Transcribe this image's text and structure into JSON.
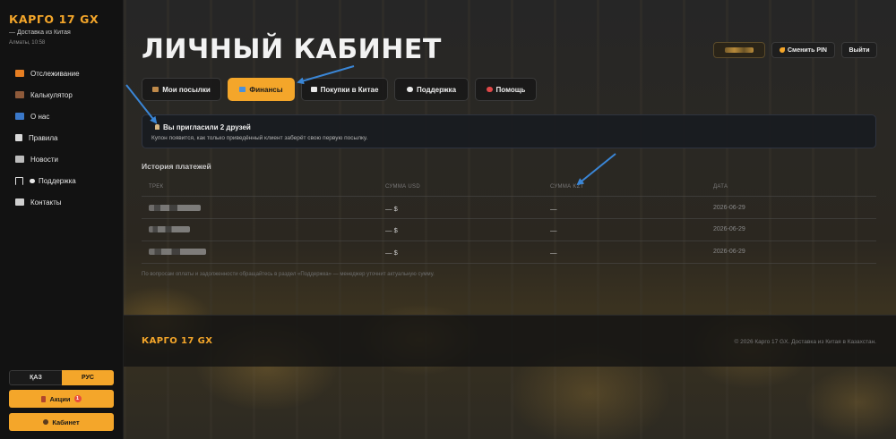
{
  "brand": {
    "name": "КАРГО 17 GX",
    "subtitle": "— Доставка из Китая",
    "location": "Алматы, 10:58"
  },
  "sidebar": {
    "items": [
      {
        "label": "Отслеживание",
        "icon": "truck-icon"
      },
      {
        "label": "Калькулятор",
        "icon": "calculator-icon"
      },
      {
        "label": "О нас",
        "icon": "info-icon"
      },
      {
        "label": "Правила",
        "icon": "document-icon"
      },
      {
        "label": "Новости",
        "icon": "news-icon"
      },
      {
        "label": "Поддержка",
        "icon": "headphones-icon"
      },
      {
        "label": "Контакты",
        "icon": "mail-icon"
      }
    ],
    "lang": {
      "kz": "ҚАЗ",
      "ru": "РУС",
      "active": "ru"
    },
    "promo_button": "Акции",
    "promo_badge": "1",
    "cabinet_button": "Кабинет"
  },
  "header": {
    "title": "ЛИЧНЫЙ КАБИНЕТ",
    "change_pin": "Сменить PIN",
    "logout": "Выйти"
  },
  "tabs": [
    {
      "label": "Мои посылки",
      "icon": "package-icon",
      "active": false
    },
    {
      "label": "Финансы",
      "icon": "card-icon",
      "active": true
    },
    {
      "label": "Покупки в Китае",
      "icon": "flag-icon",
      "active": false
    },
    {
      "label": "Поддержка",
      "icon": "chat-icon",
      "active": false
    },
    {
      "label": "Помощь",
      "icon": "question-icon",
      "active": false
    }
  ],
  "referral": {
    "title": "Вы пригласили 2 друзей",
    "subtitle": "Купон появится, как только приведённый клиент заберёт свою первую посылку."
  },
  "payments": {
    "title": "История платежей",
    "columns": [
      "ТРЕК",
      "СУММА USD",
      "СУММА KZT",
      "ДАТА"
    ],
    "rows": [
      {
        "usd": "— $",
        "kzt": "—",
        "date": "2026-06-29"
      },
      {
        "usd": "— $",
        "kzt": "—",
        "date": "2026-06-29"
      },
      {
        "usd": "— $",
        "kzt": "—",
        "date": "2026-06-29"
      }
    ],
    "note": "По вопросам оплаты и задолженности обращайтесь в раздел «Поддержка» — менеджер уточнит актуальную сумму."
  },
  "footer": {
    "brand": "КАРГО 17 GX",
    "copyright": "© 2026 Карго 17 GX. Доставка из Китая в Казахстан."
  },
  "colors": {
    "accent": "#f4a62a",
    "annotation_arrow": "#3a86d6"
  }
}
